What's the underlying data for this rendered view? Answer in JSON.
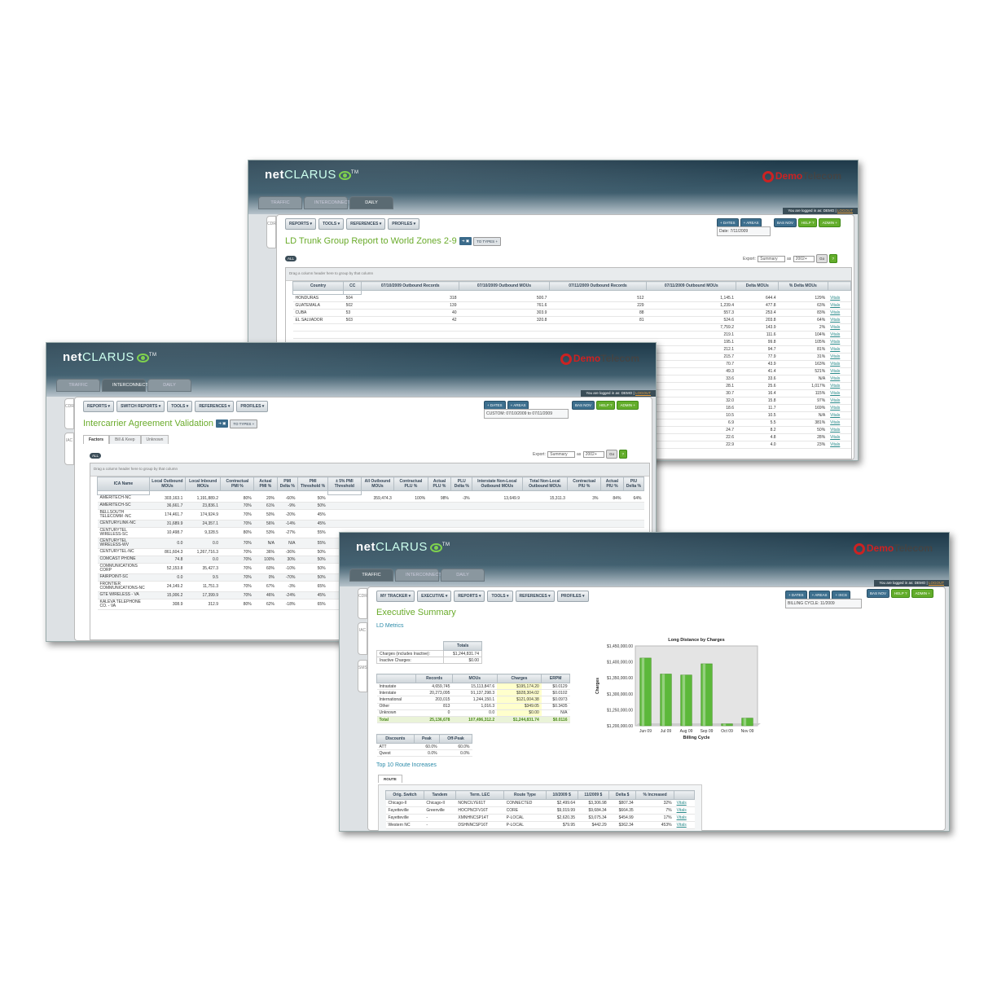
{
  "brand": {
    "net": "net",
    "clarus": "CLARUS",
    "tm": "TM",
    "company_demo": "Demo",
    "company_telecom": "Telecom"
  },
  "nav": {
    "traffic": "TRAFFIC",
    "interconnect": "INTERCONNECT",
    "daily": "DAILY"
  },
  "login": {
    "text": "You are logged in as: DEMO",
    "sep": "|",
    "logout": "LOGOUT"
  },
  "buttons": {
    "dates": "+ DATES",
    "areas": "+ AREAS",
    "ixcs": "+ IXCS",
    "bas_nov": "BAS NOV",
    "help": "HELP ?",
    "admin": "ADMIN +",
    "go": "Go",
    "all": "ALL",
    "to_types": "TO TYPES +"
  },
  "export": {
    "label": "Export:",
    "format": "Summary",
    "as": "as",
    "version": "2002+"
  },
  "drag_hint": "Drag a column header here to group by that column",
  "side": {
    "cdr": "CDR",
    "iac": "IAC",
    "sms": "SMS"
  },
  "w1": {
    "menu": [
      "REPORTS",
      "TOOLS",
      "REFERENCES",
      "PROFILES"
    ],
    "title": "LD Trunk Group Report to World Zones 2-9",
    "date": "Date: 7/11/2009",
    "columns": [
      "Country",
      "CC",
      "07/10/2009 Outbound Records",
      "07/10/2009 Outbound MOUs",
      "07/11/2009 Outbound Records",
      "07/11/2009 Outbound MOUs",
      "Delta MOUs",
      "% Delta MOUs",
      ""
    ],
    "rows": [
      [
        "HONDURAS",
        "504",
        "318",
        "500.7",
        "512",
        "1,145.1",
        "644.4",
        "129%",
        "Vitals"
      ],
      [
        "GUATEMALA",
        "502",
        "139",
        "761.6",
        "229",
        "1,239.4",
        "477.8",
        "63%",
        "Vitals"
      ],
      [
        "CUBA",
        "53",
        "40",
        "303.9",
        "88",
        "557.3",
        "253.4",
        "83%",
        "Vitals"
      ],
      [
        "EL SALVADOR",
        "503",
        "42",
        "320.8",
        "81",
        "524.6",
        "203.8",
        "64%",
        "Vitals"
      ]
    ],
    "extra": [
      [
        "7,759.2",
        "143.9",
        "2%"
      ],
      [
        "219.1",
        "111.6",
        "104%"
      ],
      [
        "195.1",
        "99.8",
        "105%"
      ],
      [
        "212.1",
        "94.7",
        "81%"
      ],
      [
        "215.7",
        "77.9",
        "31%"
      ],
      [
        "70.7",
        "43.9",
        "163%"
      ],
      [
        "49.3",
        "41.4",
        "521%"
      ],
      [
        "33.6",
        "33.6",
        "N/A"
      ],
      [
        "28.1",
        "25.6",
        "1,017%"
      ],
      [
        "30.7",
        "16.4",
        "115%"
      ],
      [
        "32.0",
        "15.8",
        "97%"
      ],
      [
        "18.6",
        "11.7",
        "169%"
      ],
      [
        "10.5",
        "10.5",
        "N/A"
      ],
      [
        "6.9",
        "5.5",
        "381%"
      ],
      [
        "24.7",
        "8.2",
        "50%"
      ],
      [
        "22.6",
        "4.8",
        "28%"
      ],
      [
        "22.9",
        "4.0",
        "23%"
      ]
    ]
  },
  "w2": {
    "menu": [
      "REPORTS",
      "SWITCH REPORTS",
      "TOOLS",
      "REFERENCES",
      "PROFILES"
    ],
    "title": "Intercarrier Agreement Validation",
    "date": "CUSTOM: 07/10/2009 to 07/11/2009",
    "subtabs": [
      "Factors",
      "Bill & Keep",
      "Unknown"
    ],
    "columns": [
      "ICA Name",
      "Local Outbound MOUs",
      "Local Inbound MOUs",
      "Contractual PMI %",
      "Actual PMI %",
      "PMI Delta %",
      "PMI Threshold %",
      "± 5% PMI Threshold",
      "All Outbound MOUs",
      "Contractual PLU %",
      "Actual PLU %",
      "PLU Delta %",
      "Interstate Non-Local Outbound MOUs",
      "Total Non-Local Outbound MOUs",
      "Contractual PIU %",
      "Actual PIU %",
      "PIU Delta %"
    ],
    "rows": [
      [
        "AMERITECH-NC",
        "303,163.1",
        "1,191,889.2",
        "80%",
        "20%",
        "-60%",
        "50%",
        "",
        "359,474.3",
        "100%",
        "98%",
        "-3%",
        "13,649.9",
        "15,311.3",
        "3%",
        "84%",
        "64%"
      ],
      [
        "AMERITECH-SC",
        "36,661.7",
        "23,836.1",
        "70%",
        "61%",
        "-9%",
        "50%"
      ],
      [
        "BELLSOUTH TELECOMM -NC",
        "174,461.7",
        "174,924.9",
        "70%",
        "50%",
        "-20%",
        "45%"
      ],
      [
        "CENTURYLINK-NC",
        "31,689.9",
        "24,357.1",
        "70%",
        "56%",
        "-14%",
        "45%"
      ],
      [
        "CENTURYTEL WIRELESS-SC",
        "10,498.7",
        "9,328.5",
        "80%",
        "53%",
        "-27%",
        "55%"
      ],
      [
        "CENTURYTEL WIRELESS-WV",
        "0.0",
        "0.0",
        "70%",
        "N/A",
        "N/A",
        "55%"
      ],
      [
        "CENTURYTEL-NC",
        "861,604.3",
        "1,267,716.3",
        "70%",
        "36%",
        "-36%",
        "50%"
      ],
      [
        "COMCAST PHONE",
        "74.8",
        "0.0",
        "70%",
        "100%",
        "30%",
        "50%"
      ],
      [
        "COMMUNICATIONS CORP",
        "52,153.8",
        "35,427.3",
        "70%",
        "60%",
        "-10%",
        "50%"
      ],
      [
        "FAIRPOINT-SC",
        "0.0",
        "9.5",
        "70%",
        "0%",
        "-70%",
        "50%"
      ],
      [
        "FRONTIER COMMUNICATIONS-NC",
        "24,149.2",
        "11,751.3",
        "70%",
        "67%",
        "-3%",
        "65%"
      ],
      [
        "GTE WIRELESS - VA",
        "15,006.2",
        "17,399.9",
        "70%",
        "46%",
        "-24%",
        "45%"
      ],
      [
        "KALEVA TELEPHONE CO. - VA",
        "308.9",
        "312.9",
        "80%",
        "62%",
        "-18%",
        "65%"
      ]
    ]
  },
  "w3": {
    "menu": [
      "MY TRACKER",
      "EXECUTIVE",
      "REPORTS",
      "TOOLS",
      "REFERENCES",
      "PROFILES"
    ],
    "title": "Executive Summary",
    "date": "BILLING CYCLE: 11/2009",
    "ld_metrics": "LD Metrics",
    "totals_header": "Totals",
    "totals": [
      [
        "Charges (includes Inactive):",
        "$1,244,831.74"
      ],
      [
        "Inactive Charges:",
        "$0.00"
      ]
    ],
    "metrics_cols": [
      "",
      "Records",
      "MOUs",
      "Charges",
      "ERPM"
    ],
    "metrics": [
      [
        "Intrastate",
        "4,659,745",
        "15,113,847.6",
        "$195,174.20",
        "$0.0129"
      ],
      [
        "Interstate",
        "20,273,095",
        "91,137,298.3",
        "$928,304.02",
        "$0.0102"
      ],
      [
        "International",
        "203,015",
        "1,244,150.1",
        "$121,004.38",
        "$0.0973"
      ],
      [
        "Other",
        "813",
        "1,016.3",
        "$349.05",
        "$0.3435"
      ],
      [
        "Unknown",
        "0",
        "0.0",
        "$0.00",
        "N/A"
      ]
    ],
    "metrics_total": [
      "Total",
      "25,136,678",
      "107,496,312.2",
      "$1,244,831.74",
      "$0.0116"
    ],
    "disc_cols": [
      "Discounts",
      "Peak",
      "Off-Peak"
    ],
    "discounts": [
      [
        "ATT",
        "60.0%",
        "60.0%"
      ],
      [
        "Qwest",
        "0.0%",
        "0.0%"
      ]
    ],
    "top10": "Top 10 Route Increases",
    "route_tab": "ROUTE",
    "route_cols": [
      "Orig. Switch",
      "Tandem",
      "Term. LEC",
      "Route Type",
      "10/2009 $",
      "11/2009 $",
      "Delta $",
      "% Increased",
      ""
    ],
    "routes": [
      [
        "Chicago-Il",
        "Chicago-Il",
        "NONCILYE61T",
        "CONNECTED",
        "$2,499.64",
        "$3,306.98",
        "$807.34",
        "32%",
        "Vitals"
      ],
      [
        "Fayetteville",
        "Greenville",
        "HOCPNCFV16T",
        "CORE",
        "$9,019.99",
        "$9,684.34",
        "$664.35",
        "7%",
        "Vitals"
      ],
      [
        "Fayetteville",
        "-",
        "XMNHNCSP14T",
        "P-LOCAL",
        "$2,620.35",
        "$3,075.34",
        "$454.99",
        "17%",
        "Vitals"
      ],
      [
        "Western NC",
        "-",
        "DSHNNCSP16T",
        "P-LOCAL",
        "$79.95",
        "$442.29",
        "$362.34",
        "453%",
        "Vitals"
      ]
    ]
  },
  "chart_data": {
    "type": "bar",
    "title": "Long Distance by Charges",
    "xlabel": "Billing Cycle",
    "ylabel": "Charges",
    "categories": [
      "Jun 09",
      "Jul 09",
      "Aug 09",
      "Sep 09",
      "Oct 09",
      "Nov 09"
    ],
    "values": [
      1412000,
      1362000,
      1359000,
      1394000,
      1206000,
      1224000
    ],
    "ylim": [
      1200000,
      1450000
    ],
    "yticks": [
      "$1,200,000.00",
      "$1,250,000.00",
      "$1,300,000.00",
      "$1,350,000.00",
      "$1,400,000.00",
      "$1,450,000.00"
    ],
    "bar_color": "#5cb83a"
  }
}
